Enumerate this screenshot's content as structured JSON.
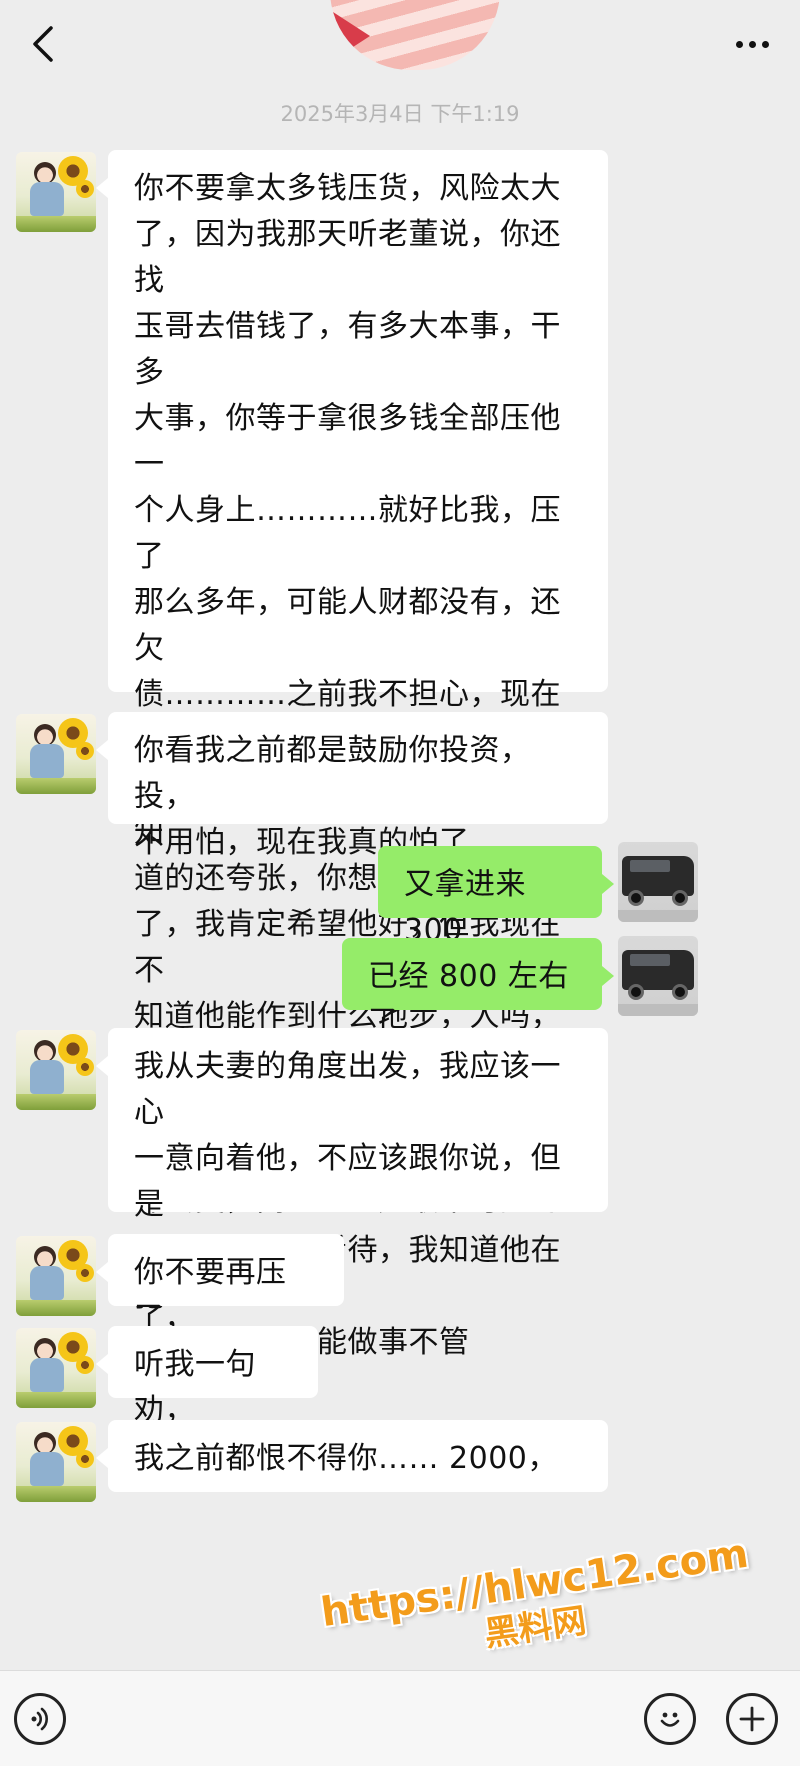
{
  "header": {
    "back_icon": "chevron-left-icon",
    "more_icon": "more-dots-icon",
    "timestamp": "2025年3月4日 下午1:19"
  },
  "messages": [
    {
      "side": "left",
      "avatar": "sunflower-girl",
      "text": "你不要拿太多钱压货，风险太大\n了，因为我那天听老董说，你还找\n玉哥去借钱了，有多大本事，干多\n大事，你等于拿很多钱全部压他一\n个人身上…………就好比我，压了\n那么多年，可能人财都没有，还欠\n债…………之前我不担心，现在真\n的说不准………我了解到的比你知\n道的还夸张，你想我全部都给他\n了，我肯定希望他好，但我现在不\n知道他能作到什么地步，人吗，随\n着环境的变化，都会变得，所有人\n都会变，而且人也是最不可控的"
    },
    {
      "side": "left",
      "avatar": "sunflower-girl",
      "text": "你看我之前都是鼓励你投资，投，\n不用怕，现在我真的怕了"
    },
    {
      "side": "right",
      "avatar": "black-car",
      "text": "又拿进来 300"
    },
    {
      "side": "right",
      "avatar": "black-car",
      "text": "已经 800 左右了"
    },
    {
      "side": "left",
      "avatar": "sunflower-girl",
      "text": "我从夫妻的角度出发，我应该一心\n一意向着他，不应该跟你说，但是\n从事实，理性看待，我知道他在犯\n错了，我就不能做事不管"
    },
    {
      "side": "left",
      "avatar": "sunflower-girl",
      "text": "你不要再压了，"
    },
    {
      "side": "left",
      "avatar": "sunflower-girl",
      "text": "听我一句劝，"
    },
    {
      "side": "left",
      "avatar": "sunflower-girl",
      "text": "我之前都恨不得你…… 2000，"
    }
  ],
  "watermark": {
    "url": "https://hlwc12.com",
    "site": "黑料网"
  },
  "input_bar": {
    "voice_icon": "voice-icon",
    "emoji_icon": "emoji-icon",
    "plus_icon": "plus-icon"
  }
}
